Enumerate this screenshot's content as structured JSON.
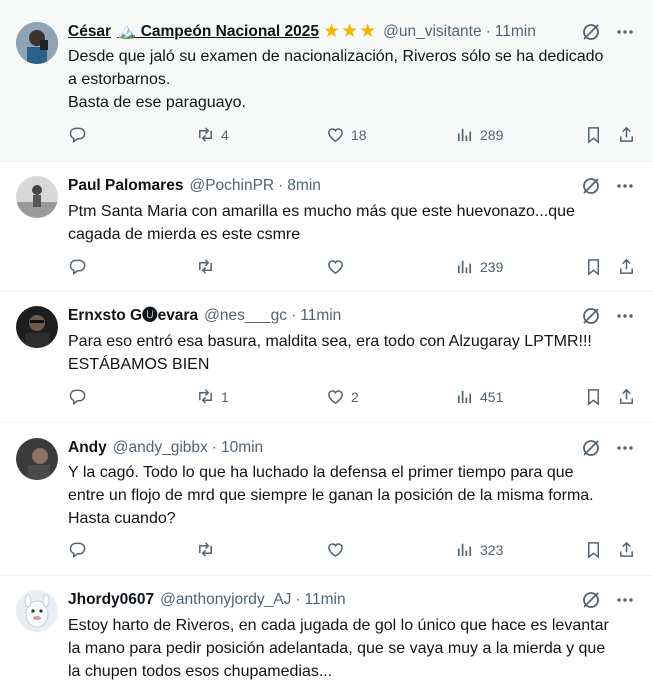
{
  "tweets": [
    {
      "name": "César",
      "name_extra": "🏔️ Campeón Nacional 2025",
      "stars": "★★★",
      "handle": "@un_visitante",
      "sep": "·",
      "time": "11min",
      "lines": [
        "Desde que jaló su examen de nacionalización, Riveros sólo se ha dedicado",
        "a estorbarnos.",
        "Basta de ese paraguayo."
      ],
      "replies": "",
      "reposts": "4",
      "likes": "18",
      "views": "289"
    },
    {
      "name": "Paul Palomares",
      "handle": "@PochinPR",
      "sep": "·",
      "time": "8min",
      "lines": [
        "Ptm Santa Maria con amarilla es mucho más que este huevonazo...que",
        "cagada de mierda es este csmre"
      ],
      "replies": "",
      "reposts": "",
      "likes": "",
      "views": "239"
    },
    {
      "name": "Ernxsto G🅤evara",
      "handle": "@nes___gc",
      "sep": "·",
      "time": "11min",
      "lines": [
        "Para eso entró esa basura, maldita sea, era todo con Alzugaray LPTMR!!!",
        "ESTÁBAMOS BIEN"
      ],
      "replies": "",
      "reposts": "1",
      "likes": "2",
      "views": "451"
    },
    {
      "name": "Andy",
      "handle": "@andy_gibbx",
      "sep": "·",
      "time": "10min",
      "lines": [
        "Y la cagó. Todo lo que ha luchado la defensa el primer tiempo para que",
        "entre un flojo de mrd que siempre le ganan la posición de la misma forma.",
        "Hasta cuando?"
      ],
      "replies": "",
      "reposts": "",
      "likes": "",
      "views": "323"
    },
    {
      "name": "Jhordy0607",
      "handle": "@anthonyjordy_AJ",
      "sep": "·",
      "time": "11min",
      "lines": [
        "Estoy harto de Riveros, en cada jugada de gol lo único que hace es levantar",
        "la mano para pedir posición adelantada, que se vaya muy a la mierda y que",
        "la chupen todos esos chupamedias..."
      ]
    }
  ]
}
